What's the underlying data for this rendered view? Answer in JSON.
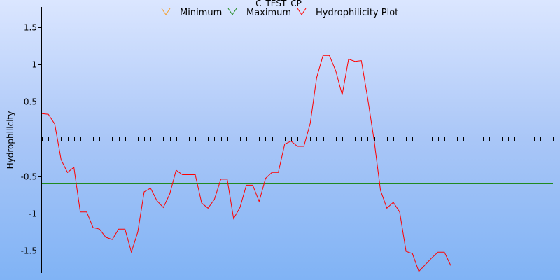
{
  "chart_data": {
    "type": "line",
    "title": "C_TEST_CP",
    "xlabel": "",
    "ylabel": "Hydrophilicity",
    "ylim": [
      -1.8,
      1.77
    ],
    "xlim": [
      0,
      80
    ],
    "legend_position": "top",
    "grid": false,
    "y_ticks": [
      {
        "value": 1.5,
        "label": "1.5"
      },
      {
        "value": 1,
        "label": "1"
      },
      {
        "value": 0.5,
        "label": "0.5"
      },
      {
        "value": -0.5,
        "label": "-0.5"
      },
      {
        "value": -1,
        "label": "-1"
      },
      {
        "value": -1.5,
        "label": "-1.5"
      }
    ],
    "series": [
      {
        "name": "Minimum",
        "color": "#f5a030",
        "style": "hline",
        "values": [
          -0.96,
          -0.96
        ]
      },
      {
        "name": "Maximum",
        "color": "#1f8a1f",
        "style": "hline",
        "values": [
          -0.6,
          -0.6
        ]
      },
      {
        "name": "Hydrophilicity Plot",
        "color": "#ff0000",
        "style": "line",
        "values": [
          0.34,
          0.33,
          0.2,
          -0.28,
          -0.45,
          -0.38,
          -0.98,
          -0.98,
          -1.19,
          -1.21,
          -1.32,
          -1.35,
          -1.21,
          -1.21,
          -1.52,
          -1.25,
          -0.71,
          -0.66,
          -0.83,
          -0.92,
          -0.74,
          -0.42,
          -0.48,
          -0.48,
          -0.48,
          -0.86,
          -0.93,
          -0.81,
          -0.54,
          -0.54,
          -1.07,
          -0.92,
          -0.62,
          -0.62,
          -0.84,
          -0.53,
          -0.45,
          -0.45,
          -0.07,
          -0.03,
          -0.1,
          -0.1,
          0.21,
          0.82,
          1.12,
          1.12,
          0.91,
          0.59,
          1.07,
          1.04,
          1.05,
          0.54,
          -0.02,
          -0.69,
          -0.93,
          -0.85,
          -0.98,
          -1.51,
          -1.54,
          -1.78,
          -1.69,
          -1.6,
          -1.52,
          -1.52,
          -1.7
        ]
      }
    ]
  }
}
